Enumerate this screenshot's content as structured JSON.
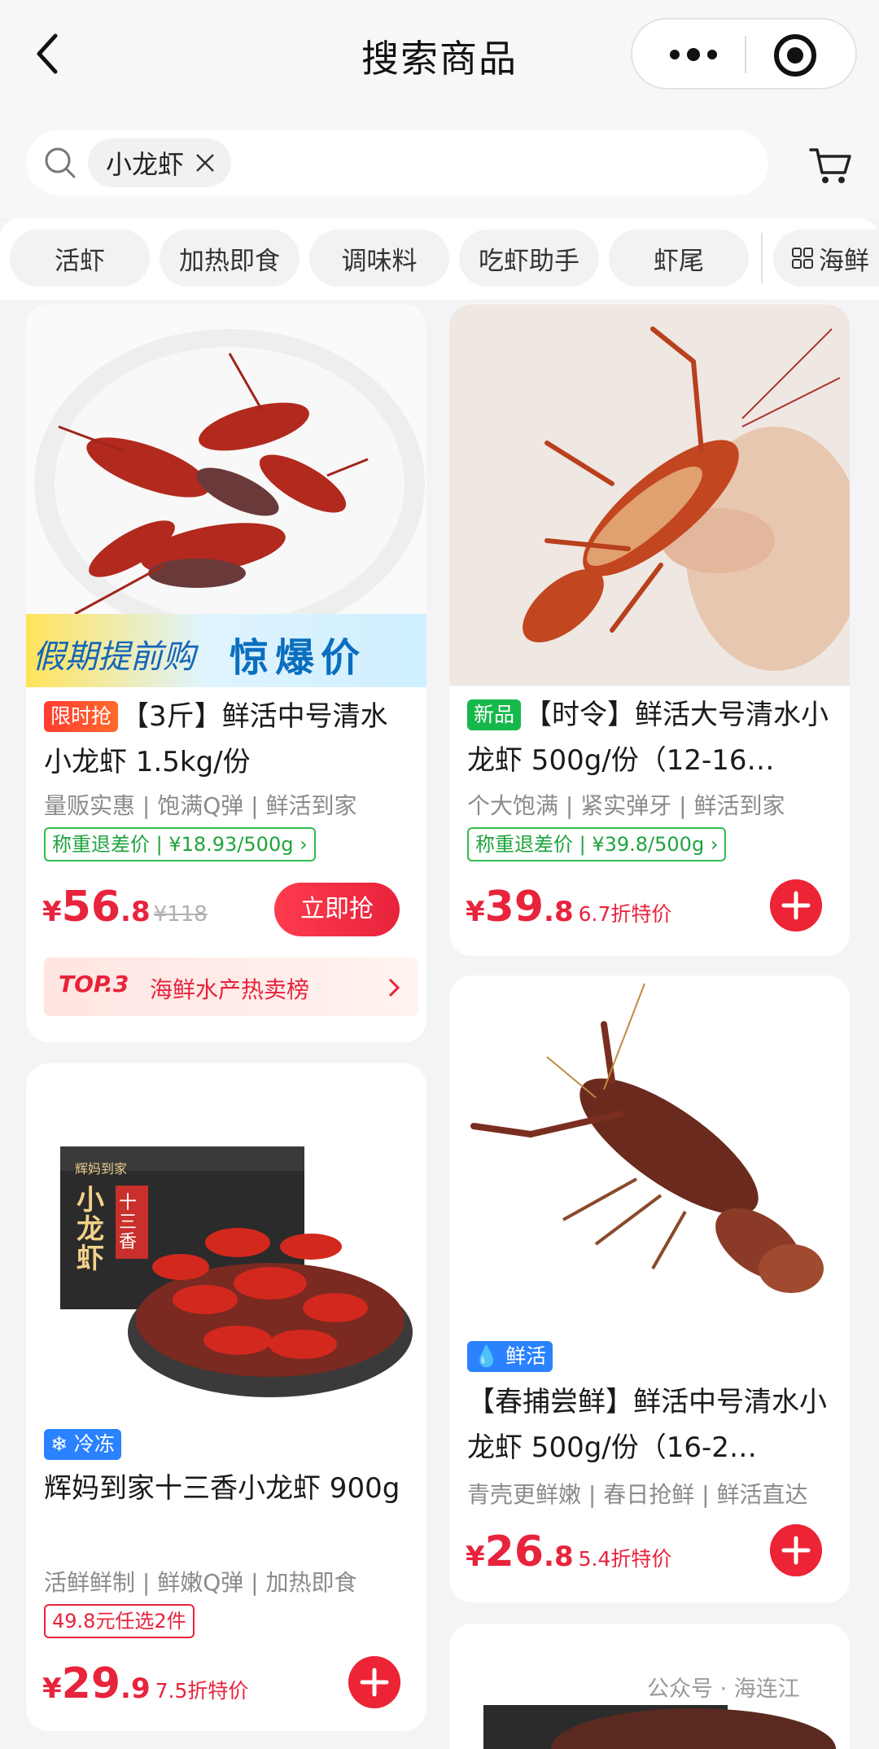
{
  "header": {
    "title": "搜索商品",
    "back_icon": "back-arrow-icon",
    "more_icon": "more-dots-icon",
    "close_icon": "mini-program-close-icon"
  },
  "search": {
    "chip": "小龙虾",
    "clear_icon": "close-x-icon",
    "cart_icon": "shopping-cart-icon"
  },
  "categories": [
    "活虾",
    "加热即食",
    "调味料",
    "吃虾助手",
    "虾尾"
  ],
  "category_all": "海鲜",
  "products": [
    {
      "badge": "限时抢",
      "title": "【3斤】鲜活中号清水小龙虾 1.5kg/份",
      "banner_left": "假期提前购",
      "banner_right": "惊爆价",
      "tags": "量贩实惠 | 饱满Q弹 | 鲜活到家",
      "weigh_tag": "称重退差价 | ¥18.93/500g",
      "yen": "¥",
      "price_int": "56",
      "price_dec": ".8",
      "orig_price": "¥118",
      "buy_label": "立即抢",
      "rank_top": "TOP.3",
      "rank_text": "海鲜水产热卖榜"
    },
    {
      "badge": "新品",
      "title": "【时令】鲜活大号清水小龙虾 500g/份（12-16…",
      "tags": "个大饱满 | 紧实弹牙 | 鲜活到家",
      "weigh_tag": "称重退差价 | ¥39.8/500g",
      "yen": "¥",
      "price_int": "39",
      "price_dec": ".8",
      "discount": "6.7折特价"
    },
    {
      "badge": "冷冻",
      "title": "辉妈到家十三香小龙虾 900g",
      "box_brand": "辉妈到家",
      "box_name": "小龙虾",
      "box_flavor": "十三香",
      "tags": "活鲜鲜制 | 鲜嫩Q弹 | 加热即食",
      "promo": "49.8元任选2件",
      "yen": "¥",
      "price_int": "29",
      "price_dec": ".9",
      "discount": "7.5折特价"
    },
    {
      "badge": "鲜活",
      "title": "【春捕尝鲜】鲜活中号清水小龙虾 500g/份（16-2…",
      "tags": "青壳更鲜嫩 | 春日抢鲜 | 鲜活直达",
      "yen": "¥",
      "price_int": "26",
      "price_dec": ".8",
      "discount": "5.4折特价"
    }
  ],
  "watermark": "公众号 · 海连江",
  "colors": {
    "accent": "#e8233c",
    "green": "#17b84b",
    "blue": "#2a82ff"
  }
}
